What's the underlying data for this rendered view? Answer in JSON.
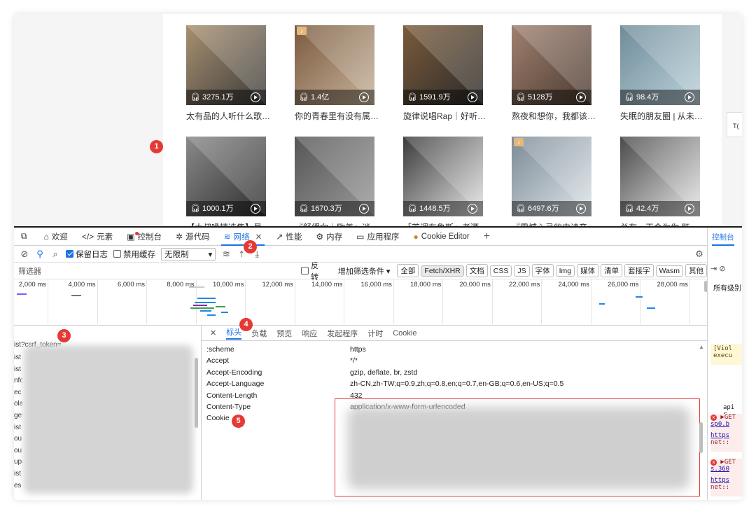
{
  "page": {
    "cards": [
      {
        "plays": "3275.1万",
        "title": "太有品的人听什么歌…",
        "colors": [
          "#3b3b3b",
          "#a89070"
        ],
        "badge": ""
      },
      {
        "plays": "1.4亿",
        "title": "你的青春里有没有属…",
        "colors": [
          "#c8b49a",
          "#7a5a40"
        ],
        "badge": "♪"
      },
      {
        "plays": "1591.9万",
        "title": "旋律说唱Rap｜好听…",
        "colors": [
          "#2a2a2a",
          "#7b5b3a"
        ],
        "badge": ""
      },
      {
        "plays": "5128万",
        "title": "熬夜和想你，我都该…",
        "colors": [
          "#4a3a30",
          "#a08070"
        ],
        "badge": ""
      },
      {
        "plays": "98.4万",
        "title": "失眠的朋友圈 | 从未…",
        "colors": [
          "#bcd2dc",
          "#6f8c99"
        ],
        "badge": ""
      },
      {
        "plays": "1000.1万",
        "title": "【大叔嗓精选集】最…",
        "colors": [
          "#2e2e2e",
          "#8a8a8a"
        ],
        "badge": ""
      },
      {
        "plays": "1670.3万",
        "title": "『舒缓向｜欧美』迷…",
        "colors": [
          "#9a9a9a",
          "#565656"
        ],
        "badge": ""
      },
      {
        "plays": "1448.5万",
        "title": "「英调布鲁斯」老酒…",
        "colors": [
          "#e6e6e6",
          "#3a3a3a"
        ],
        "badge": ""
      },
      {
        "plays": "6497.6万",
        "title": "『震撼心灵的史诗音…",
        "colors": [
          "#dfe6ea",
          "#7b8a96"
        ],
        "badge": "♪"
      },
      {
        "plays": "42.4万",
        "title": "总有一天会为你 既…",
        "colors": [
          "#e8e8e8",
          "#4a4a4a"
        ],
        "badge": ""
      }
    ],
    "side_tab": "T("
  },
  "annotations": [
    "1",
    "2",
    "3",
    "4",
    "5"
  ],
  "devtools": {
    "tabs": [
      {
        "icon": "⧉",
        "label": "",
        "name": "device-toggle"
      },
      {
        "icon": "⌂",
        "label": "欢迎",
        "name": "welcome"
      },
      {
        "icon": "</>",
        "label": "元素",
        "name": "elements"
      },
      {
        "icon": "▣",
        "label": "控制台",
        "name": "console"
      },
      {
        "icon": "✲",
        "label": "源代码",
        "name": "sources"
      },
      {
        "icon": "≋",
        "label": "网络",
        "name": "network"
      },
      {
        "icon": "↗",
        "label": "性能",
        "name": "performance"
      },
      {
        "icon": "⚙",
        "label": "内存",
        "name": "memory"
      },
      {
        "icon": "▭",
        "label": "应用程序",
        "name": "application"
      },
      {
        "icon": "●",
        "label": "Cookie Editor",
        "name": "cookie-editor"
      }
    ],
    "close_glyph": "✕",
    "add_glyph": "+",
    "toolbar": {
      "preserve_log": "保留日志",
      "disable_cache": "禁用缓存",
      "throttle": "无限制"
    },
    "filter": {
      "placeholder": "筛选器",
      "invert": "反转",
      "more_filters": "增加筛选条件 ▾",
      "chips": [
        "全部",
        "Fetch/XHR",
        "文档",
        "CSS",
        "JS",
        "字体",
        "Img",
        "媒体",
        "清单",
        "套接字",
        "Wasm",
        "其他"
      ]
    },
    "timeline": {
      "ticks": [
        "2,000 ms",
        "4,000 ms",
        "6,000 ms",
        "8,000 ms",
        "10,000 ms",
        "12,000 ms",
        "14,000 ms",
        "16,000 ms",
        "18,000 ms",
        "20,000 ms",
        "22,000 ms",
        "24,000 ms",
        "26,000 ms",
        "28,000 ms"
      ]
    },
    "requests": {
      "selected": "ist?csrf_token=",
      "rows": [
        "ist",
        "ist",
        "nfo",
        "ec",
        "ola",
        "get",
        "ist",
        "ou",
        "ou",
        "upd",
        "ist",
        "es"
      ]
    },
    "detail_tabs": [
      "标头",
      "负载",
      "预览",
      "响应",
      "发起程序",
      "计时",
      "Cookie"
    ],
    "headers": [
      {
        "name": ":scheme",
        "value": "https"
      },
      {
        "name": "Accept",
        "value": "*/*"
      },
      {
        "name": "Accept-Encoding",
        "value": "gzip, deflate, br, zstd"
      },
      {
        "name": "Accept-Language",
        "value": "zh-CN,zh-TW;q=0.9,zh;q=0.8,en;q=0.7,en-GB;q=0.6,en-US;q=0.5"
      },
      {
        "name": "Content-Length",
        "value": "432"
      },
      {
        "name": "Content-Type",
        "value": "application/x-www-form-urlencoded"
      },
      {
        "name": "Cookie",
        "value": ""
      }
    ],
    "console": {
      "title": "控制台",
      "levels": "所有级别",
      "warn": [
        "[Viol",
        "execu"
      ],
      "api": "api r",
      "errors": [
        {
          "line1": "▶GET",
          "line2": "sp0.b",
          "line3": "https",
          "line4": "net::"
        },
        {
          "line1": "▶GET",
          "line2": "s.360",
          "line3": "https",
          "line4": "net::"
        }
      ]
    }
  }
}
